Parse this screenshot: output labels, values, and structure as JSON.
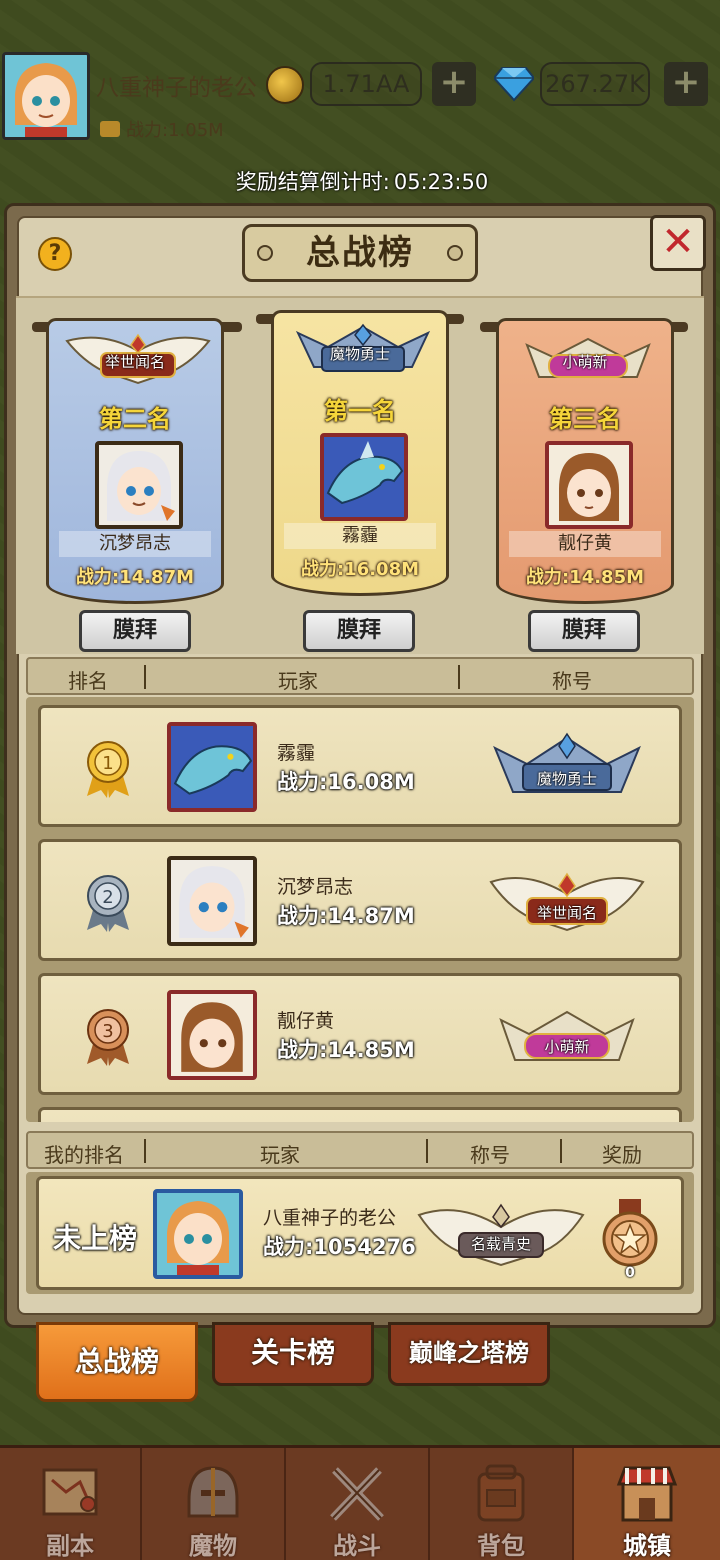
{
  "player": {
    "name": "八重神子的老公",
    "power_label": "战力:1.05M",
    "gold": "1.71AA",
    "gems": "267.27K",
    "plus": "+"
  },
  "countdown": {
    "label": "奖励结算倒计时:",
    "value": "05:23:50"
  },
  "panel": {
    "title": "总战榜",
    "help": "?",
    "close": "✕"
  },
  "podium": [
    {
      "rank_title": "第二名",
      "badge": "举世闻名",
      "name": "沉梦昂志",
      "power": "战力:14.87M",
      "worship": "膜拜"
    },
    {
      "rank_title": "第一名",
      "badge": "魔物勇士",
      "name": "霧霾",
      "power": "战力:16.08M",
      "worship": "膜拜"
    },
    {
      "rank_title": "第三名",
      "badge": "小萌新",
      "name": "靓仔黄",
      "power": "战力:14.85M",
      "worship": "膜拜"
    }
  ],
  "list_header": {
    "rank": "排名",
    "player": "玩家",
    "title": "称号"
  },
  "rows": [
    {
      "medal": "1",
      "name": "霧霾",
      "power": "战力:16.08M",
      "badge": "魔物勇士"
    },
    {
      "medal": "2",
      "name": "沉梦昂志",
      "power": "战力:14.87M",
      "badge": "举世闻名"
    },
    {
      "medal": "3",
      "name": "靓仔黄",
      "power": "战力:14.85M",
      "badge": "小萌新"
    }
  ],
  "my_header": {
    "rank": "我的排名",
    "player": "玩家",
    "title": "称号",
    "reward": "奖励"
  },
  "my_row": {
    "status": "未上榜",
    "name": "八重神子的老公",
    "power": "战力:1054276",
    "badge": "名载青史",
    "reward_count": "0"
  },
  "tabs": [
    {
      "label": "总战榜",
      "active": true
    },
    {
      "label": "关卡榜",
      "active": false
    },
    {
      "label": "巅峰之塔榜",
      "active": false
    }
  ],
  "nav": [
    {
      "label": "副本",
      "icon": "map-scroll-icon"
    },
    {
      "label": "魔物",
      "icon": "monster-helmet-icon"
    },
    {
      "label": "战斗",
      "icon": "crossed-swords-icon"
    },
    {
      "label": "背包",
      "icon": "backpack-icon"
    },
    {
      "label": "城镇",
      "icon": "town-shop-icon"
    }
  ],
  "colors": {
    "accent_orange": "#f2901f",
    "gold_text": "#f5d53a",
    "close_red": "#c1272d",
    "panel_bg": "#d9cfb0"
  }
}
